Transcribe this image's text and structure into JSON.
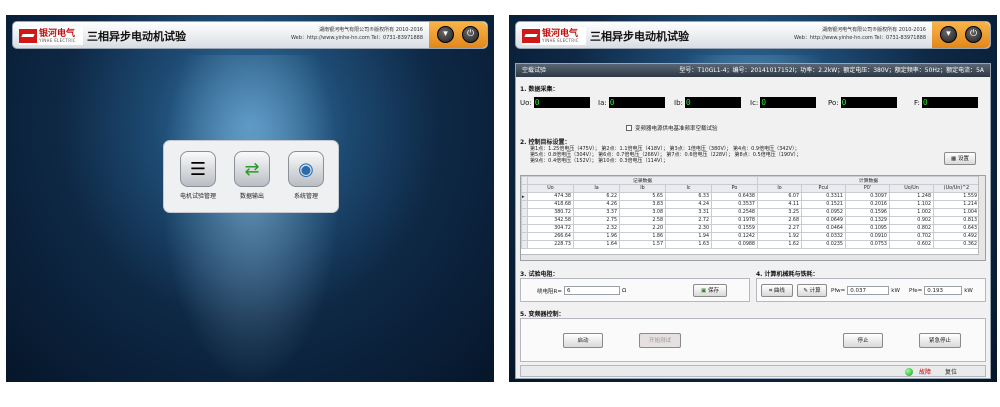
{
  "header": {
    "logo_cn": "银河电气",
    "logo_en": "YINHE ELECTRIC",
    "title": "三相异步电动机试验",
    "company": "湖南银河电气有限公司®版权所有  2010-2016",
    "contact": "Web：http://www.yinhe-hn.com   Tel：0731-83971888"
  },
  "menu": {
    "items": [
      {
        "label": "电机试验管理",
        "icon": "document-icon"
      },
      {
        "label": "数据输出",
        "icon": "transfer-icon"
      },
      {
        "label": "系统管理",
        "icon": "disc-icon"
      }
    ]
  },
  "window": {
    "title": "空载试验",
    "info": "型号：T10GL1-4；编号：20141017152I；功率：2.2kW；额定电压：380V；额定频率：50Hz；额定电流：5A"
  },
  "acquisition": {
    "title": "1. 数据采集：",
    "fields": [
      {
        "label": "Uo:",
        "value": "0"
      },
      {
        "label": "Ia:",
        "value": "0"
      },
      {
        "label": "Ib:",
        "value": "0"
      },
      {
        "label": "Ic:",
        "value": "0"
      },
      {
        "label": "Po:",
        "value": "0"
      },
      {
        "label": "F:",
        "value": "0"
      }
    ],
    "checkbox_label": "变频器电源供电基准频率空载试验"
  },
  "targets": {
    "title": "2. 控制目标设置：",
    "lines": [
      "第1点：1.25倍电压（475V）；   第2点：1.1倍电压（418V）；   第3点：1倍电压（380V）；   第4点：0.9倍电压（342V）；",
      "   第5点：0.8倍电压（304V）；   第6点：0.7倍电压（266V）；   第7点：0.6倍电压（228V）；   第8点：0.5倍电压（190V）；",
      "第9点：0.4倍电压（152V）；   第10点：0.3倍电压（114V）；"
    ],
    "set_button": "设置"
  },
  "table": {
    "group_record": "记录数据",
    "group_calc": "计算数据",
    "headers": [
      "Uo",
      "Ia",
      "Ib",
      "Ic",
      "Po",
      "Io",
      "Pcul",
      "P0'",
      "Uo/Un",
      "(Uo/Un)^2"
    ],
    "rows": [
      [
        "474.38",
        "6.22",
        "5.65",
        "6.33",
        "0.6438",
        "6.07",
        "0.3311",
        "0.3097",
        "1.248",
        "1.559"
      ],
      [
        "418.68",
        "4.26",
        "3.83",
        "4.24",
        "0.3537",
        "4.11",
        "0.1521",
        "0.2016",
        "1.102",
        "1.214"
      ],
      [
        "380.72",
        "3.37",
        "3.08",
        "3.31",
        "0.2548",
        "3.25",
        "0.0952",
        "0.1596",
        "1.002",
        "1.004"
      ],
      [
        "342.58",
        "2.75",
        "2.58",
        "2.72",
        "0.1978",
        "2.68",
        "0.0649",
        "0.1329",
        "0.902",
        "0.813"
      ],
      [
        "304.72",
        "2.32",
        "2.20",
        "2.30",
        "0.1559",
        "2.27",
        "0.0464",
        "0.1095",
        "0.802",
        "0.643"
      ],
      [
        "266.64",
        "1.96",
        "1.86",
        "1.94",
        "0.1242",
        "1.92",
        "0.0332",
        "0.0910",
        "0.702",
        "0.492"
      ],
      [
        "228.73",
        "1.64",
        "1.57",
        "1.63",
        "0.0988",
        "1.62",
        "0.0235",
        "0.0753",
        "0.602",
        "0.362"
      ]
    ]
  },
  "test_resistance": {
    "title": "3. 试验电阻：",
    "label": "绕电阻R=",
    "value": "6",
    "unit": "Ω",
    "save_button": "保存"
  },
  "calc": {
    "title": "4. 计算机械耗与铁耗：",
    "curve_button": "曲线",
    "calc_button": "计算",
    "pfw_label": "Pfw=",
    "pfw_value": "0.037",
    "pfw_unit": "kW",
    "pfe_label": "Pfe=",
    "pfe_value": "0.193",
    "pfe_unit": "kW"
  },
  "inverter": {
    "title": "5. 变频器控制：",
    "start_button": "启动",
    "begin_test_button": "开始测试",
    "stop_button": "停止",
    "emergency_button": "紧急停止"
  },
  "status": {
    "fault_label": "故障",
    "reset_label": "复位"
  },
  "colors": {
    "accent_orange": "#e8921f",
    "display_green": "#2fe33a",
    "fault_red": "#c00000"
  }
}
